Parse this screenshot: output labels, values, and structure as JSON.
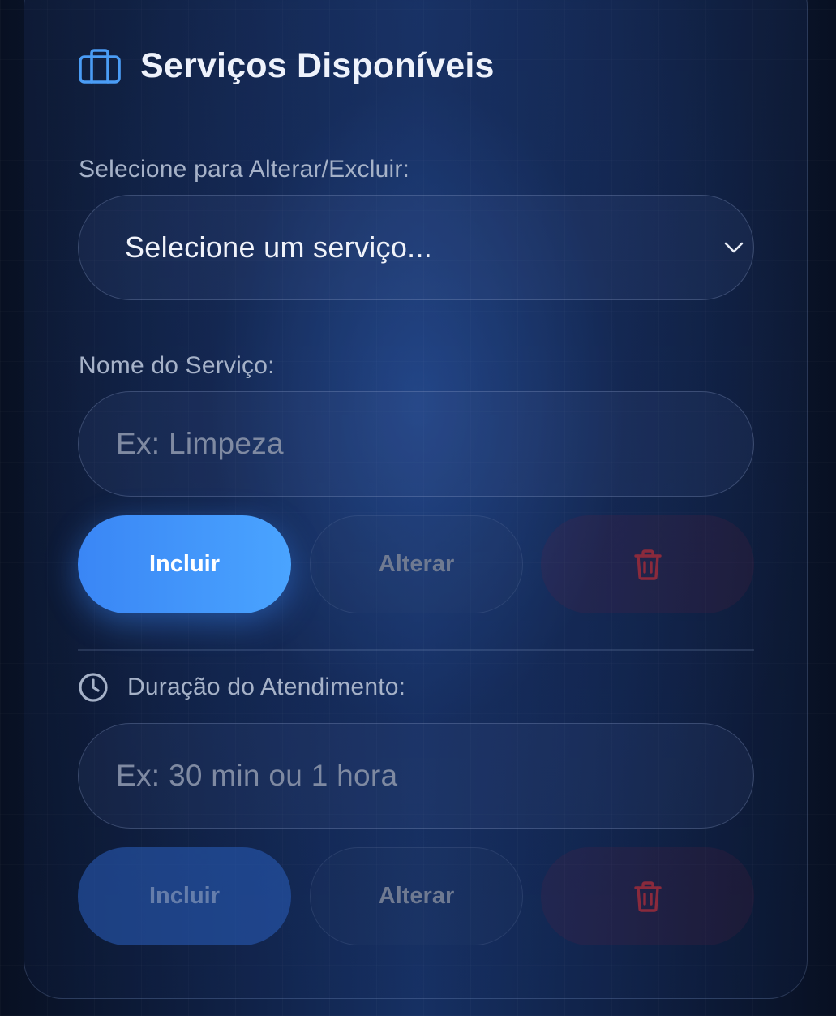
{
  "section": {
    "title": "Serviços Disponíveis",
    "icon": "briefcase-icon",
    "accent_color": "#4a9cf5"
  },
  "select_service": {
    "label": "Selecione para Alterar/Excluir:",
    "selected_value": "Selecione um serviço...",
    "icon": "chevron-down-icon"
  },
  "service_name": {
    "label": "Nome do Serviço:",
    "placeholder": "Ex: Limpeza",
    "value": "",
    "buttons": {
      "include_label": "Incluir",
      "edit_label": "Alterar",
      "delete_icon": "trash-icon"
    }
  },
  "duration": {
    "label": "Duração do Atendimento:",
    "icon": "clock-icon",
    "placeholder": "Ex: 30 min ou 1 hora",
    "value": "",
    "buttons": {
      "include_label": "Incluir",
      "edit_label": "Alterar",
      "delete_icon": "trash-icon"
    }
  },
  "colors": {
    "primary": "#3a86f5",
    "danger": "#8a2a3c",
    "text": "#eef2fb",
    "muted": "#a6b2c8"
  }
}
